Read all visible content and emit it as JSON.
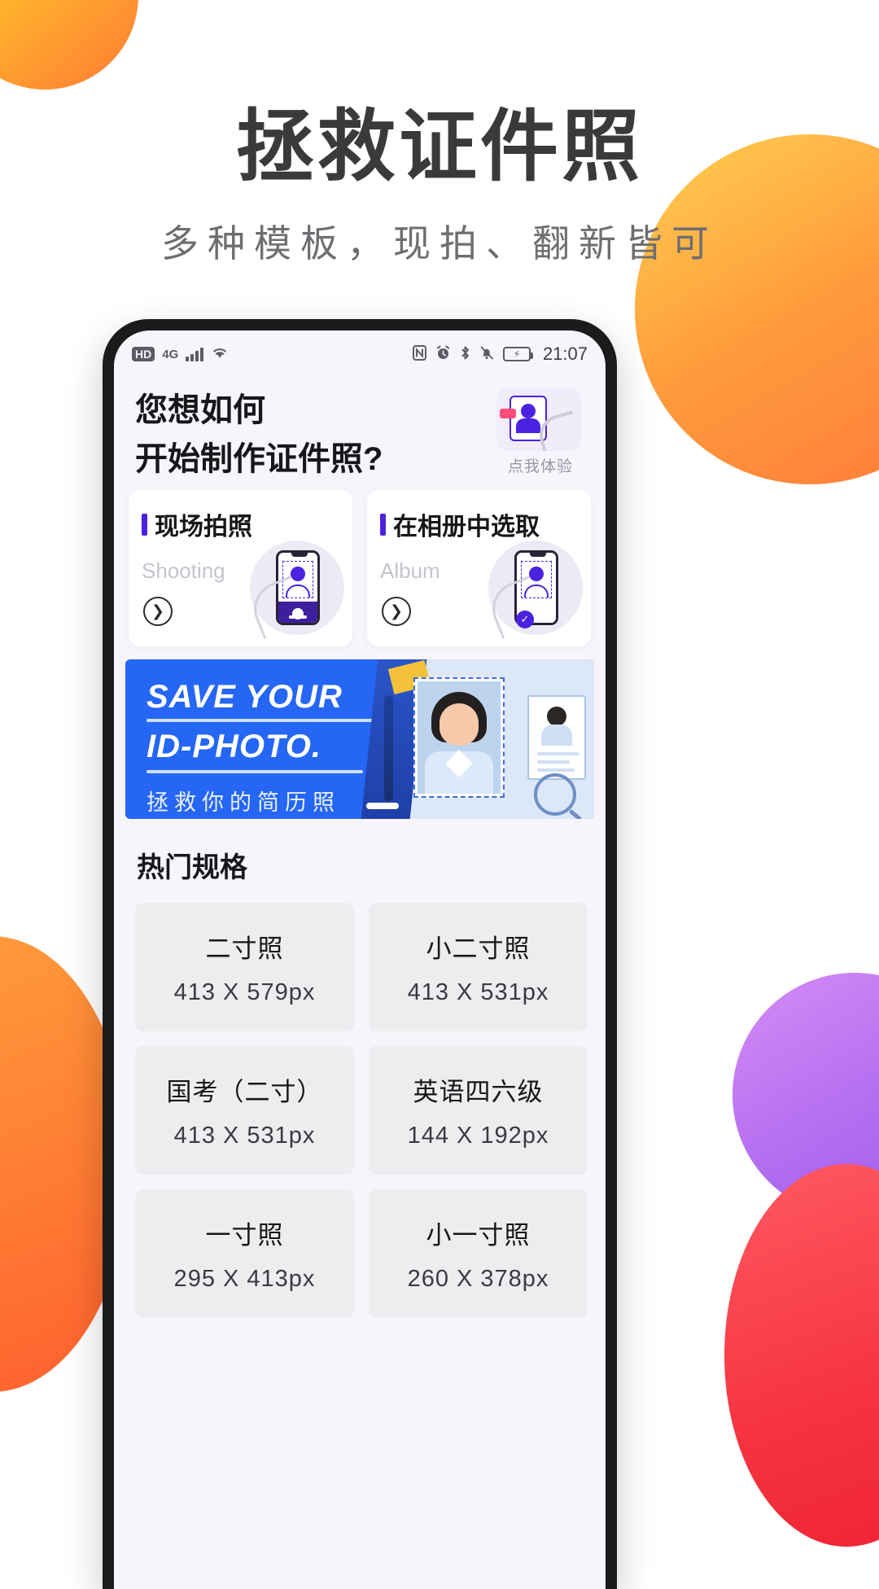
{
  "hero": {
    "title": "拯救证件照",
    "subtitle": "多种模板，现拍、翻新皆可"
  },
  "colors": {
    "accent_purple": "#4A22E0",
    "banner_blue": "#2566F5",
    "title_gray": "#3A3A3C",
    "subtitle_gray": "#6E6E72"
  },
  "phone": {
    "status_bar": {
      "hd_label": "HD",
      "network_label": "4G",
      "time": "21:07",
      "icons": [
        "hd-badge",
        "signal-bars-icon",
        "wifi-icon",
        "nfc-icon",
        "alarm-icon",
        "bluetooth-icon",
        "mute-bell-icon",
        "battery-charging-icon"
      ],
      "nfc_glyph": "Ⓝ",
      "alarm_glyph": "⏰",
      "bluetooth_glyph": "✱",
      "bell_glyph": "🔕",
      "battery_glyph": "⚡"
    },
    "app": {
      "heading": "您想如何\n开始制作证件照?",
      "experience_label": "点我体验",
      "option_cards": [
        {
          "title": "现场拍照",
          "subtitle": "Shooting",
          "arrow": "❯",
          "art": "camera-shooting-illustration"
        },
        {
          "title": "在相册中选取",
          "subtitle": "Album",
          "arrow": "❯",
          "art": "album-select-illustration"
        }
      ],
      "banner": {
        "line1": "SAVE YOUR",
        "line2": "ID-PHOTO.",
        "chinese": "拯救你的简历照",
        "check_glyph": "✓"
      },
      "specs_title": "热门规格",
      "specs": [
        {
          "name": "二寸照",
          "size": "413 X 579px"
        },
        {
          "name": "小二寸照",
          "size": "413 X 531px"
        },
        {
          "name": "国考（二寸）",
          "size": "413 X 531px"
        },
        {
          "name": "英语四六级",
          "size": "144 X 192px"
        },
        {
          "name": "一寸照",
          "size": "295 X 413px"
        },
        {
          "name": "小一寸照",
          "size": "260 X 378px"
        }
      ]
    }
  }
}
